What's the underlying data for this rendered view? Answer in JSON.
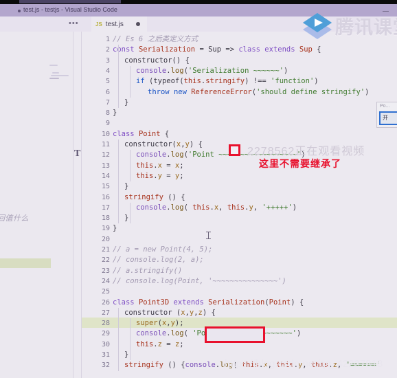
{
  "window": {
    "title": "test.js - testjs - Visual Studio Code",
    "minimize_label": "—"
  },
  "tabbar": {
    "ellipsis": "•••",
    "tab": {
      "icon_label": "JS",
      "name": "test.js",
      "modified_indicator": "●"
    }
  },
  "left_panel": {
    "ghost_text": "回值什么",
    "vertical_glyph": "T"
  },
  "overlays": {
    "red_annotation": "这里不需要继承了",
    "watermark_viewer": "2278562正在观看视频",
    "watermark_blog": "https://blog.csdn.net/qq_42227818",
    "logo_text": "腾讯课堂"
  },
  "popup": {
    "title": "Po...",
    "button_label": "开"
  },
  "editor": {
    "highlighted_line": 28,
    "first_line": 1,
    "line_count": 32,
    "line_numbers": [
      1,
      2,
      3,
      4,
      5,
      6,
      7,
      8,
      9,
      10,
      11,
      12,
      13,
      14,
      15,
      16,
      17,
      18,
      19,
      20,
      21,
      22,
      23,
      24,
      25,
      26,
      27,
      28,
      29,
      30,
      31,
      32
    ],
    "lines": [
      {
        "n": 1,
        "indent": 0,
        "tokens": [
          {
            "t": "// Es 6 之后类定义方式",
            "c": "cmt"
          }
        ]
      },
      {
        "n": 2,
        "indent": 0,
        "tokens": [
          {
            "t": "const ",
            "c": "k"
          },
          {
            "t": "Serialization",
            "c": "cls"
          },
          {
            "t": " = ",
            "c": "pl"
          },
          {
            "t": "Sup",
            "c": "pl"
          },
          {
            "t": " => ",
            "c": "pl"
          },
          {
            "t": "class",
            "c": "k"
          },
          {
            "t": " ",
            "c": "pl"
          },
          {
            "t": "extends",
            "c": "k"
          },
          {
            "t": " ",
            "c": "pl"
          },
          {
            "t": "Sup",
            "c": "cls"
          },
          {
            "t": " {",
            "c": "pl"
          }
        ]
      },
      {
        "n": 3,
        "indent": 1,
        "tokens": [
          {
            "t": "constructor",
            "c": "pl"
          },
          {
            "t": "() {",
            "c": "pl"
          }
        ]
      },
      {
        "n": 4,
        "indent": 2,
        "tokens": [
          {
            "t": "console",
            "c": "fn"
          },
          {
            "t": ".",
            "c": "pl"
          },
          {
            "t": "log",
            "c": "mth"
          },
          {
            "t": "(",
            "c": "pl"
          },
          {
            "t": "'Serialization ~~~~~~'",
            "c": "str"
          },
          {
            "t": ")",
            "c": "pl"
          }
        ]
      },
      {
        "n": 5,
        "indent": 2,
        "tokens": [
          {
            "t": "if",
            "c": "k2"
          },
          {
            "t": " (",
            "c": "pl"
          },
          {
            "t": "typeof",
            "c": "pl"
          },
          {
            "t": "(",
            "c": "pl"
          },
          {
            "t": "this",
            "c": "cls"
          },
          {
            "t": ".",
            "c": "pl"
          },
          {
            "t": "stringify",
            "c": "cls"
          },
          {
            "t": ") !== ",
            "c": "pl"
          },
          {
            "t": "'function'",
            "c": "str"
          },
          {
            "t": ")",
            "c": "pl"
          }
        ]
      },
      {
        "n": 6,
        "indent": 3,
        "tokens": [
          {
            "t": "throw",
            "c": "k2"
          },
          {
            "t": " ",
            "c": "pl"
          },
          {
            "t": "new",
            "c": "k2"
          },
          {
            "t": " ",
            "c": "pl"
          },
          {
            "t": "ReferenceError",
            "c": "cls"
          },
          {
            "t": "(",
            "c": "pl"
          },
          {
            "t": "'should define stringify'",
            "c": "str"
          },
          {
            "t": ")",
            "c": "pl"
          }
        ]
      },
      {
        "n": 7,
        "indent": 1,
        "tokens": [
          {
            "t": "}",
            "c": "pl"
          }
        ]
      },
      {
        "n": 8,
        "indent": 0,
        "tokens": [
          {
            "t": "}",
            "c": "pl"
          }
        ]
      },
      {
        "n": 9,
        "indent": 0,
        "tokens": []
      },
      {
        "n": 10,
        "indent": 0,
        "tokens": [
          {
            "t": "class",
            "c": "k"
          },
          {
            "t": " ",
            "c": "pl"
          },
          {
            "t": "Point",
            "c": "cls"
          },
          {
            "t": " {",
            "c": "pl"
          }
        ]
      },
      {
        "n": 11,
        "indent": 1,
        "tokens": [
          {
            "t": "constructor",
            "c": "pl"
          },
          {
            "t": "(",
            "c": "pl"
          },
          {
            "t": "x",
            "c": "var"
          },
          {
            "t": ",",
            "c": "pl"
          },
          {
            "t": "y",
            "c": "var"
          },
          {
            "t": ") {",
            "c": "pl"
          }
        ]
      },
      {
        "n": 12,
        "indent": 2,
        "tokens": [
          {
            "t": "console",
            "c": "fn"
          },
          {
            "t": ".",
            "c": "pl"
          },
          {
            "t": "log",
            "c": "mth"
          },
          {
            "t": "(",
            "c": "pl"
          },
          {
            "t": "'Point ~~~~~~~~~~~~~~~~~~'",
            "c": "str"
          },
          {
            "t": ")",
            "c": "pl"
          }
        ]
      },
      {
        "n": 13,
        "indent": 2,
        "tokens": [
          {
            "t": "this",
            "c": "cls"
          },
          {
            "t": ".",
            "c": "pl"
          },
          {
            "t": "x",
            "c": "var"
          },
          {
            "t": " = ",
            "c": "pl"
          },
          {
            "t": "x",
            "c": "var"
          },
          {
            "t": ";",
            "c": "pl"
          }
        ]
      },
      {
        "n": 14,
        "indent": 2,
        "tokens": [
          {
            "t": "this",
            "c": "cls"
          },
          {
            "t": ".",
            "c": "pl"
          },
          {
            "t": "y",
            "c": "var"
          },
          {
            "t": " = ",
            "c": "pl"
          },
          {
            "t": "y",
            "c": "var"
          },
          {
            "t": ";",
            "c": "pl"
          }
        ]
      },
      {
        "n": 15,
        "indent": 1,
        "tokens": [
          {
            "t": "}",
            "c": "pl"
          }
        ]
      },
      {
        "n": 16,
        "indent": 1,
        "tokens": [
          {
            "t": "stringify",
            "c": "cls"
          },
          {
            "t": " () {",
            "c": "pl"
          }
        ]
      },
      {
        "n": 17,
        "indent": 2,
        "tokens": [
          {
            "t": "console",
            "c": "fn"
          },
          {
            "t": ".",
            "c": "pl"
          },
          {
            "t": "log",
            "c": "mth"
          },
          {
            "t": "( ",
            "c": "pl"
          },
          {
            "t": "this",
            "c": "cls"
          },
          {
            "t": ".",
            "c": "pl"
          },
          {
            "t": "x",
            "c": "var"
          },
          {
            "t": ", ",
            "c": "pl"
          },
          {
            "t": "this",
            "c": "cls"
          },
          {
            "t": ".",
            "c": "pl"
          },
          {
            "t": "y",
            "c": "var"
          },
          {
            "t": ", ",
            "c": "pl"
          },
          {
            "t": "'+++++'",
            "c": "str"
          },
          {
            "t": ")",
            "c": "pl"
          }
        ]
      },
      {
        "n": 18,
        "indent": 1,
        "tokens": [
          {
            "t": "}",
            "c": "pl"
          }
        ]
      },
      {
        "n": 19,
        "indent": 0,
        "tokens": [
          {
            "t": "}",
            "c": "pl"
          }
        ]
      },
      {
        "n": 20,
        "indent": 0,
        "tokens": []
      },
      {
        "n": 21,
        "indent": 0,
        "tokens": [
          {
            "t": "// a = new Point(4, 5);",
            "c": "cmt"
          }
        ]
      },
      {
        "n": 22,
        "indent": 0,
        "tokens": [
          {
            "t": "// console.log(2, a);",
            "c": "cmt"
          }
        ]
      },
      {
        "n": 23,
        "indent": 0,
        "tokens": [
          {
            "t": "// a.stringify()",
            "c": "cmt"
          }
        ]
      },
      {
        "n": 24,
        "indent": 0,
        "tokens": [
          {
            "t": "// console.log(Point, '~~~~~~~~~~~~~~~')",
            "c": "cmt"
          }
        ]
      },
      {
        "n": 25,
        "indent": 0,
        "tokens": []
      },
      {
        "n": 26,
        "indent": 0,
        "tokens": [
          {
            "t": "class",
            "c": "k"
          },
          {
            "t": " ",
            "c": "pl"
          },
          {
            "t": "Point3D",
            "c": "cls"
          },
          {
            "t": " ",
            "c": "pl"
          },
          {
            "t": "extends",
            "c": "k"
          },
          {
            "t": " ",
            "c": "pl"
          },
          {
            "t": "Serialization",
            "c": "cls"
          },
          {
            "t": "(",
            "c": "pl"
          },
          {
            "t": "Point",
            "c": "cls"
          },
          {
            "t": ") {",
            "c": "pl"
          }
        ]
      },
      {
        "n": 27,
        "indent": 1,
        "tokens": [
          {
            "t": "constructor",
            "c": "pl"
          },
          {
            "t": " (",
            "c": "pl"
          },
          {
            "t": "x",
            "c": "var"
          },
          {
            "t": ",",
            "c": "pl"
          },
          {
            "t": "y",
            "c": "var"
          },
          {
            "t": ",",
            "c": "pl"
          },
          {
            "t": "z",
            "c": "var"
          },
          {
            "t": ") {",
            "c": "pl"
          }
        ]
      },
      {
        "n": 28,
        "indent": 2,
        "tokens": [
          {
            "t": "super",
            "c": "var"
          },
          {
            "t": "(",
            "c": "pl"
          },
          {
            "t": "x",
            "c": "var"
          },
          {
            "t": ",",
            "c": "pl"
          },
          {
            "t": "y",
            "c": "var"
          },
          {
            "t": ");",
            "c": "pl"
          }
        ]
      },
      {
        "n": 29,
        "indent": 2,
        "tokens": [
          {
            "t": "console",
            "c": "fn"
          },
          {
            "t": ".",
            "c": "pl"
          },
          {
            "t": "log",
            "c": "mth"
          },
          {
            "t": "( ",
            "c": "pl"
          },
          {
            "t": "'Point3D ~~~~~~~~~~~~~~'",
            "c": "str"
          },
          {
            "t": ")",
            "c": "pl"
          }
        ]
      },
      {
        "n": 30,
        "indent": 2,
        "tokens": [
          {
            "t": "this",
            "c": "cls"
          },
          {
            "t": ".",
            "c": "pl"
          },
          {
            "t": "z",
            "c": "var"
          },
          {
            "t": " = ",
            "c": "pl"
          },
          {
            "t": "z",
            "c": "var"
          },
          {
            "t": ";",
            "c": "pl"
          }
        ]
      },
      {
        "n": 31,
        "indent": 1,
        "tokens": [
          {
            "t": "}",
            "c": "pl"
          }
        ]
      },
      {
        "n": 32,
        "indent": 1,
        "tokens": [
          {
            "t": "stringify",
            "c": "cls"
          },
          {
            "t": " () {",
            "c": "pl"
          },
          {
            "t": "console",
            "c": "fn"
          },
          {
            "t": ".",
            "c": "pl"
          },
          {
            "t": "log",
            "c": "mth"
          },
          {
            "t": "( ",
            "c": "pl"
          },
          {
            "t": "this",
            "c": "cls"
          },
          {
            "t": ".",
            "c": "pl"
          },
          {
            "t": "x",
            "c": "var"
          },
          {
            "t": ", ",
            "c": "pl"
          },
          {
            "t": "this",
            "c": "cls"
          },
          {
            "t": ".",
            "c": "pl"
          },
          {
            "t": "y",
            "c": "var"
          },
          {
            "t": ", ",
            "c": "pl"
          },
          {
            "t": "this",
            "c": "cls"
          },
          {
            "t": ".",
            "c": "pl"
          },
          {
            "t": "z",
            "c": "var"
          },
          {
            "t": ", ",
            "c": "pl"
          },
          {
            "t": "'======'",
            "c": "str"
          }
        ]
      }
    ]
  },
  "colors": {
    "titlebar_bg": "#b3a6cd",
    "editor_bg": "#ece9f0",
    "highlight_line": "#dfe4c8",
    "annotation_red": "#e8112d",
    "string_green": "#3f7a2e",
    "keyword_purple": "#7f4fc4",
    "class_red": "#a6311b"
  }
}
